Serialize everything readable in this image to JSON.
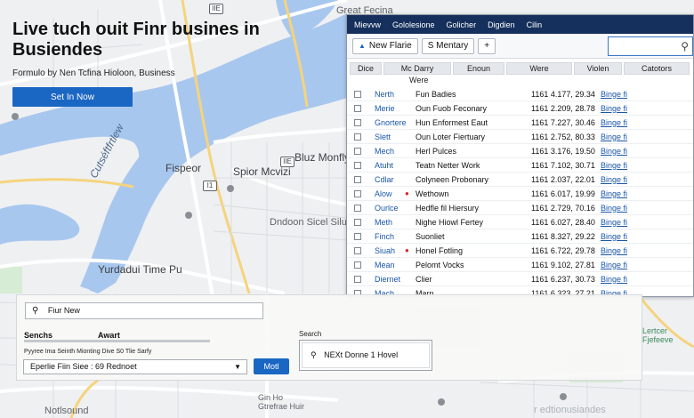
{
  "hero": {
    "title": "Live tuch ouit Finr busines in Busiendes",
    "subtitle": "Formulo by Nen Tcfina Hioloon, Business",
    "cta": "Set In Now"
  },
  "map": {
    "labels": {
      "top_right": "Great Fecina",
      "river": "Cutséftfrtlew",
      "district1": "Fispeor",
      "district2": "Spior Mcvizi",
      "district3": "Bluz Monfly",
      "district4": "Dndoon Sicel Silu",
      "district5": "Yurdadui Time Pu",
      "district6": "Gin Ho\nGtrefrae Huir",
      "district7": "Notlsound",
      "district8": "Lertcer\nFjefeeve",
      "shield1": "IIE",
      "shield2": "I1",
      "shield3": "IIE"
    }
  },
  "window": {
    "menu": [
      "Mievvw",
      "Gololesione",
      "Golicher",
      "Digdien",
      "Cilin"
    ],
    "toolbar": {
      "new_label": "New Flarie",
      "mentary_label": "S Mentary",
      "add_label": "+"
    },
    "columns": [
      "Dice",
      "Mc Darry",
      "Enoun",
      "Were",
      "Violen",
      "Catotors"
    ],
    "subheader": "Were",
    "rows": [
      {
        "name": "Nerth",
        "pin": "",
        "desc": "Fun Badies",
        "num": "1161 4.177, 29.34",
        "act": "Binge fi"
      },
      {
        "name": "Merie",
        "pin": "",
        "desc": "Oun Fuob Feconary",
        "num": "1161 2.209, 28.78",
        "act": "Binge fi"
      },
      {
        "name": "Gnortere",
        "pin": "",
        "desc": "Hun Enformest Eaut",
        "num": "1161 7.227, 30.46",
        "act": "Binge fi"
      },
      {
        "name": "Slett",
        "pin": "",
        "desc": "Oun Loter Fiertuary",
        "num": "1161 2.752, 80.33",
        "act": "Binge fi"
      },
      {
        "name": "Mech",
        "pin": "",
        "desc": "Herl Pulces",
        "num": "1161 3.176, 19.50",
        "act": "Binge fi"
      },
      {
        "name": "Atuht",
        "pin": "",
        "desc": "Teatn Netter Work",
        "num": "1161 7.102, 30.71",
        "act": "Binge fi"
      },
      {
        "name": "Cdlar",
        "pin": "",
        "desc": "Colyneen Probonary",
        "num": "1161 2.037, 22.01",
        "act": "Binge fi"
      },
      {
        "name": "Alow",
        "pin": "●",
        "desc": "Wethown",
        "num": "1161 6.017, 19.99",
        "act": "Binge fi"
      },
      {
        "name": "Ourlce",
        "pin": "",
        "desc": "Hedfle fil Hiersury",
        "num": "1161 2.729, 70.16",
        "act": "Binge fi"
      },
      {
        "name": "Meth",
        "pin": "",
        "desc": "Nighe Hiowl Fertey",
        "num": "1161 6.027, 28.40",
        "act": "Binge fi"
      },
      {
        "name": "Finch",
        "pin": "",
        "desc": "Suonliet",
        "num": "1161 8.327, 29.22",
        "act": "Binge fi"
      },
      {
        "name": "Siuah",
        "pin": "●",
        "desc": "Honel Fotling",
        "num": "1161 6.722, 29.78",
        "act": "Binge fi"
      },
      {
        "name": "Mean",
        "pin": "",
        "desc": "Pelomt Vocks",
        "num": "1161 9.102, 27.81",
        "act": "Binge fi"
      },
      {
        "name": "Diernet",
        "pin": "",
        "desc": "Clier",
        "num": "1161 6.237, 30.73",
        "act": "Binge fi"
      },
      {
        "name": "Mach",
        "pin": "",
        "desc": "Marn",
        "num": "1161 6.323, 27.21",
        "act": "Binge fi"
      }
    ]
  },
  "panel": {
    "search_value": "Fiur New",
    "tab1": "Senchs",
    "tab2": "Awart",
    "hint": "Pyyree Ima Seinth Mionting Dive S0 Tlie Sarfy",
    "select_value": "Eperlie Fiin Siee : 69 Rednoet",
    "go_label": "Motl",
    "right_label": "Search",
    "right_value": "NEXt Donne 1 Hovel"
  },
  "watermark": "r edtionusiandes"
}
